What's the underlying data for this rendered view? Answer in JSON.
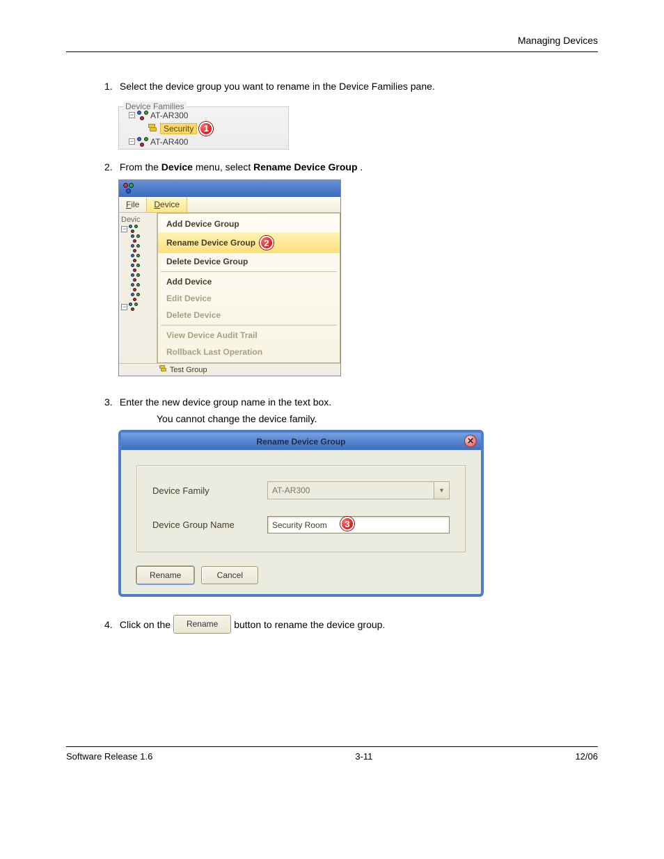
{
  "header": {
    "right": "Managing Devices"
  },
  "steps": {
    "s1": {
      "num": "1.",
      "text": "Select the device group you want to rename in the Device Families pane."
    },
    "s2": {
      "num": "2.",
      "text_before": "From the ",
      "bold": "Device",
      "text_mid": " menu, select ",
      "bold2": "Rename Device Group",
      "text_after": "."
    },
    "s3": {
      "num": "3.",
      "text": "Enter the new device group name in the text box.",
      "cont": "You cannot change the device family."
    },
    "s4": {
      "num": "4.",
      "pre": "Click on the",
      "btn": "Rename",
      "post": "button to rename the device group."
    }
  },
  "fig1": {
    "legend": "Device Families",
    "node_ar300": "AT-AR300",
    "node_security": "Security",
    "node_ar400": "AT-AR400",
    "badge": "1"
  },
  "fig2": {
    "menubar": {
      "file": "File",
      "device": "Device"
    },
    "left_legend": "Devic",
    "menu": {
      "add_group": "Add Device Group",
      "rename_group": "Rename Device Group",
      "delete_group": "Delete Device Group",
      "add_device": "Add Device",
      "edit_device": "Edit Device",
      "delete_device": "Delete Device",
      "audit": "View Device Audit Trail",
      "rollback": "Rollback Last Operation"
    },
    "hidden_row": "Test Group",
    "badge": "2"
  },
  "fig3": {
    "title": "Rename Device Group",
    "label_family": "Device Family",
    "value_family": "AT-AR300",
    "label_name": "Device Group Name",
    "value_name": "Security Room",
    "badge": "3",
    "btn_rename": "Rename",
    "btn_cancel": "Cancel",
    "close_glyph": "✕"
  },
  "footer": {
    "left": "Software Release 1.6",
    "center": "3-11",
    "right": "12/06"
  }
}
